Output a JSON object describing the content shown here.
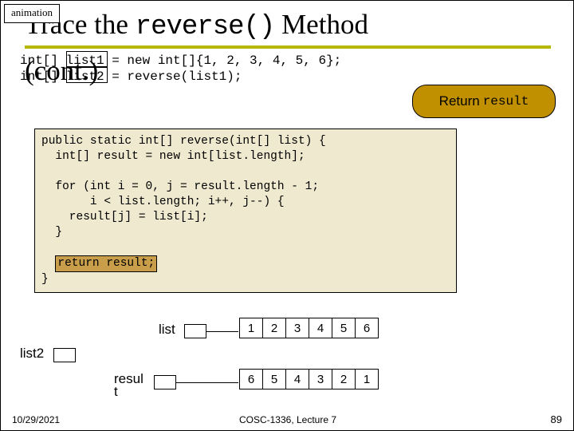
{
  "anim_label": "animation",
  "title_pre": "Trace the ",
  "title_mono": "reverse()",
  "title_post": " Method",
  "cont": "(cont.)",
  "decl_line1": "int[] list1 = new int[]{1, 2, 3, 4, 5, 6};",
  "decl_line2": "int[] list2 = reverse(list1);",
  "bubble_label": "Return",
  "bubble_mono": "result",
  "code_l1": "public static int[] reverse(int[] list) {",
  "code_l2": "  int[] result = new int[list.length];",
  "code_l3": "",
  "code_l4": "  for (int i = 0, j = result.length - 1;",
  "code_l5": "       i < list.length; i++, j--) {",
  "code_l6": "    result[j] = list[i];",
  "code_l7": "  }",
  "code_l8": "",
  "code_return": "return result;",
  "code_l10": "}",
  "labels": {
    "list": "list",
    "list2": "list2",
    "result": "resul\nt"
  },
  "arr_list": [
    "1",
    "2",
    "3",
    "4",
    "5",
    "6"
  ],
  "arr_result": [
    "6",
    "5",
    "4",
    "3",
    "2",
    "1"
  ],
  "footer": {
    "date": "10/29/2021",
    "center": "COSC-1336, Lecture 7",
    "page": "89"
  }
}
